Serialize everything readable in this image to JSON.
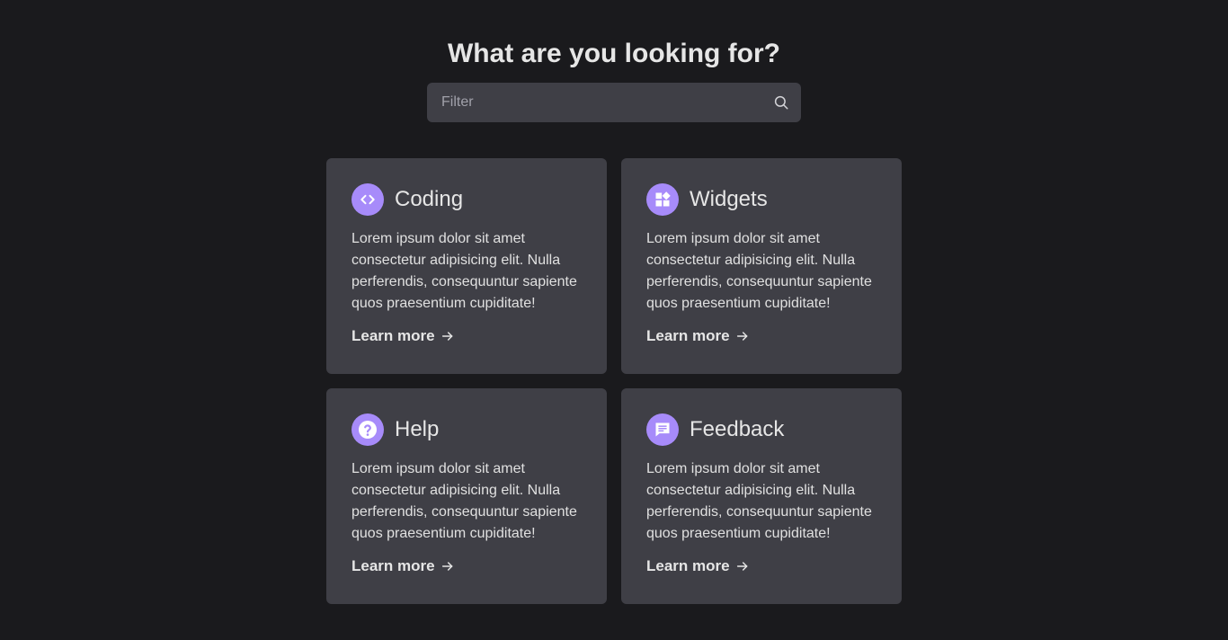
{
  "page": {
    "heading": "What are you looking for?"
  },
  "search": {
    "placeholder": "Filter",
    "icon": "search-icon"
  },
  "colors": {
    "background": "#1a1a1d",
    "card": "#3f3f46",
    "accent": "#a78bfa",
    "text": "#e6e6e6"
  },
  "cards": [
    {
      "title": "Coding",
      "icon": "code-icon",
      "text": "Lorem ipsum dolor sit amet consectetur adipisicing elit. Nulla perferendis, consequuntur sapiente quos praesentium cupiditate!",
      "link": "Learn more"
    },
    {
      "title": "Widgets",
      "icon": "widgets-icon",
      "text": "Lorem ipsum dolor sit amet consectetur adipisicing elit. Nulla perferendis, consequuntur sapiente quos praesentium cupiditate!",
      "link": "Learn more"
    },
    {
      "title": "Help",
      "icon": "question-icon",
      "text": "Lorem ipsum dolor sit amet consectetur adipisicing elit. Nulla perferendis, consequuntur sapiente quos praesentium cupiditate!",
      "link": "Learn more"
    },
    {
      "title": "Feedback",
      "icon": "chat-bubble-icon",
      "text": "Lorem ipsum dolor sit amet consectetur adipisicing elit. Nulla perferendis, consequuntur sapiente quos praesentium cupiditate!",
      "link": "Learn more"
    }
  ]
}
